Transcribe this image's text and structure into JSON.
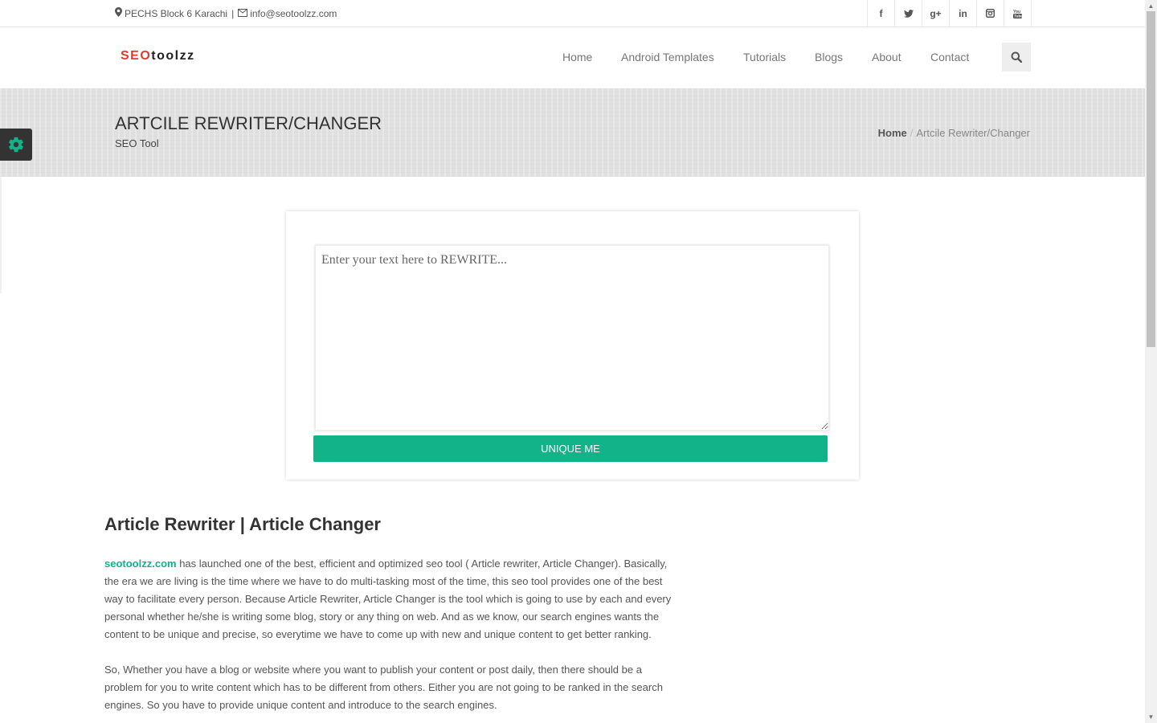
{
  "topbar": {
    "address": "PECHS Block 6 Karachi",
    "separator": "|",
    "email": "info@seotoolzz.com",
    "socials": [
      {
        "icon": "facebook-icon",
        "glyph": "f"
      },
      {
        "icon": "twitter-icon",
        "glyph": "🐦"
      },
      {
        "icon": "google-plus-icon",
        "glyph": "g+"
      },
      {
        "icon": "linkedin-icon",
        "glyph": "in"
      },
      {
        "icon": "instagram-icon",
        "glyph": "◙"
      },
      {
        "icon": "youtube-icon",
        "glyph": "▶"
      }
    ]
  },
  "logo": {
    "part1": "SEO",
    "part2": "toolzz",
    "color_part1": "#e03a2f"
  },
  "nav": {
    "items": [
      "Home",
      "Android Templates",
      "Tutorials",
      "Blogs",
      "About",
      "Contact"
    ]
  },
  "banner": {
    "title": "ARTCILE REWRITER/CHANGER",
    "subtitle": "SEO Tool",
    "breadcrumb": {
      "home": "Home",
      "separator": "/",
      "current": "Artcile Rewriter/Changer"
    }
  },
  "tool": {
    "textarea_placeholder": "Enter your text here to REWRITE...",
    "textarea_value": "",
    "button_label": "UNIQUE ME",
    "accent": "#12b388"
  },
  "article": {
    "heading": "Article Rewriter | Article Changer",
    "p1_link": "seotoolzz.com",
    "p1_text": " has launched one of the best, efficient and optimized seo tool ( Article rewriter, Article Changer). Basically, the era we are living is the time where we have to do multi-tasking most of the time, this seo tool provides one of the best way to facilitate every person. Because Article Rewriter, Article Changer is the tool which is going to use by each and every personal whether he/she is writing some blog, story or any thing on web. And as we know, our search engines wants the content to be unique and precise, so everytime we have to come up with new and unique content to get better ranking.",
    "p2_text": "So, Whether you have a blog or website where you want to publish your content or post daily, then there should be a problem for you to write content which has to be different from others. Either you are not going to be ranked in the search engines. So you have to provide unique content and introduce to the search engines."
  }
}
